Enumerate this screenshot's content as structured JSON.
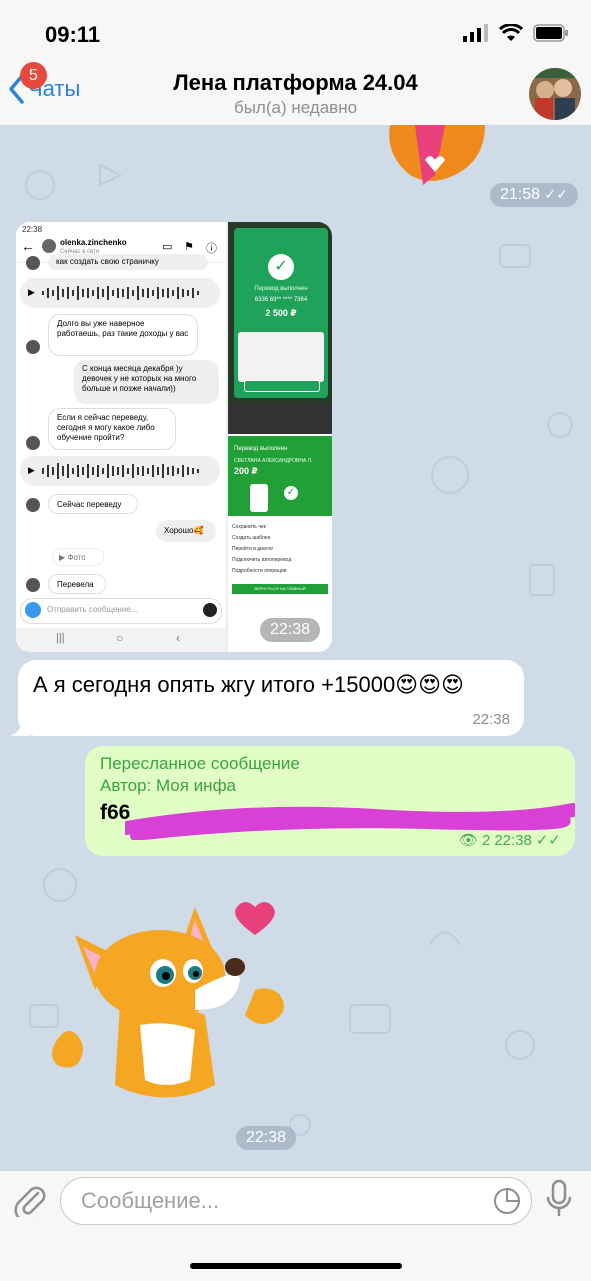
{
  "status": {
    "time": "09:11"
  },
  "header": {
    "back_label": "Чаты",
    "badge_count": "5",
    "title": "Лена платформа 24.04",
    "subtitle": "был(а) недавно"
  },
  "messages": {
    "sticker_top_time": "21:58",
    "album_time": "22:38",
    "incoming_text": "А я сегодня опять жгу итого +15000😍😍😍",
    "incoming_time": "22:38",
    "forward": {
      "label": "Пересланное сообщение",
      "author": "Автор: Моя инфа",
      "text_visible": "f66",
      "views": "2",
      "time": "22:38"
    },
    "sticker_bottom_time": "22:38"
  },
  "screenshot1": {
    "time": "22:38",
    "username": "olenka.zinchenko",
    "online": "Сейчас в сети",
    "msg1": "как создать свою страничку",
    "msg2": "Долго вы уже наверное работаешь, раз такие доходы у вас",
    "msg3": "С конца месяца декабря )у девочек у не которых на много больше и позже начали))",
    "msg4": "Если я сейчас переведу, сегодня я могу какое либо обучение пройти?",
    "msg5": "Сейчас переведу",
    "msg6": "Хорошо🥰",
    "msg7": "▶ Фото",
    "msg8": "Перевела",
    "input_placeholder": "Отправить сообщение..."
  },
  "screenshot2": {
    "status": "Перевод выполнен",
    "card": "6336 69** **** 7364",
    "amount": "2 500 ₽"
  },
  "screenshot3": {
    "status": "Перевод выполнен",
    "name": "СВЕТЛАНА АЛЕКСАНДРОВНА Л.",
    "amount": "200 ₽",
    "items": [
      "Сохранить чек",
      "Создать шаблон",
      "Перейти в диалог",
      "Подключить автоперевод",
      "Подробности операции"
    ],
    "button": "ВЕРНУТЬСЯ НА ГЛАВНЫЙ"
  },
  "input": {
    "placeholder": "Сообщение..."
  },
  "colors": {
    "accent": "#2b82d9",
    "outgoing": "#e1fec6",
    "forward_green": "#3aa43d"
  }
}
